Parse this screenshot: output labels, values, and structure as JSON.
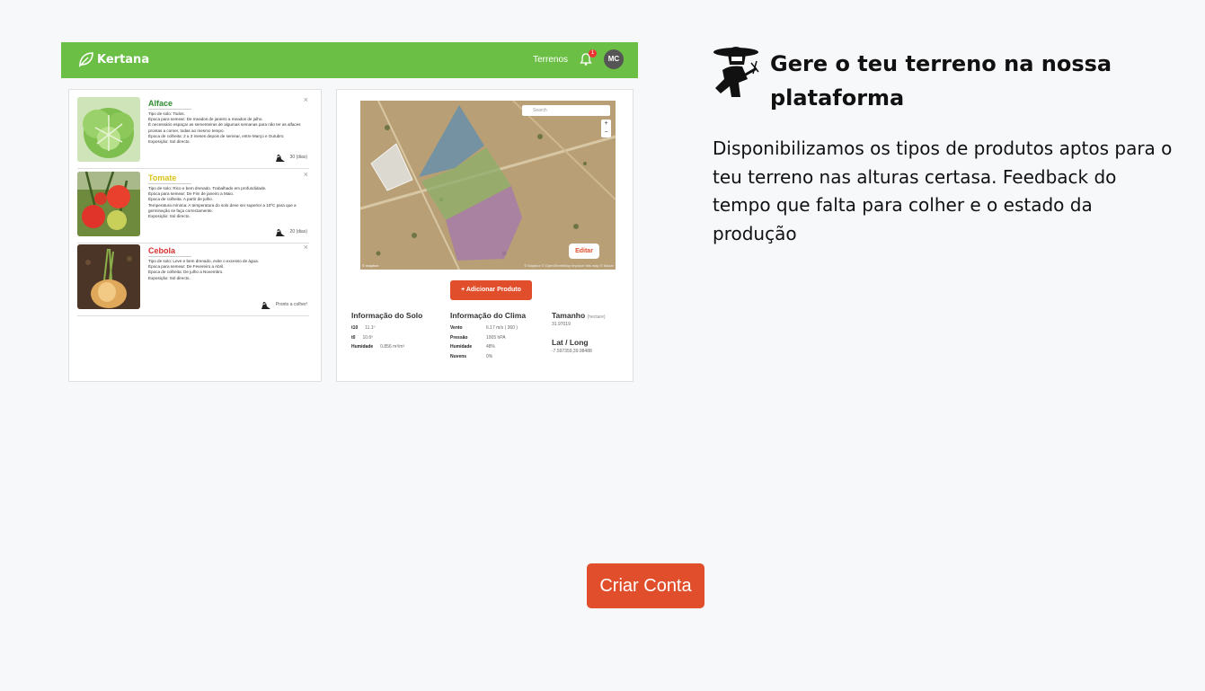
{
  "app": {
    "brand": "Kertana",
    "nav": {
      "terrenos": "Terrenos",
      "notifications": "1",
      "avatar_initials": "MC"
    }
  },
  "crops": [
    {
      "name": "Alface",
      "name_color": "#2e8b2e",
      "description": "Tipo de solo: Todos.\nÉpoca para semear: De meados de janeiro a meados de julho.\nÉ necessário espaçar as sementeiras de algumas semanas para não ter as alfaces prontas a comer, todas ao mesmo tempo.\nÉpoca de colheita: 2 a 3 meses depois de semear, entre Março e Outubro.\nExposição: Sol directo.",
      "meta": "30 (dias)",
      "close": "×"
    },
    {
      "name": "Tomate",
      "name_color": "#d8c31a",
      "description": "Tipo de solo: Rico e bem drenado. Trabalhado em profundidade.\nÉpoca para semear: De Fim de janeiro a Maio.\nÉpoca de colheita: A partir de julho.\nTemperatura mínima: A temperatura do solo deve ser superior a 10ºC para que a germinação se faça correctamente.\nExposição: Sol directo.",
      "meta": "20 (dias)",
      "close": "×"
    },
    {
      "name": "Cebola",
      "name_color": "#d83030",
      "description": "Tipo de solo: Leve e bem drenado, evite o excesso de água.\nÉpoca para semear: De Fevereiro a Abril.\nÉpoca de colheita: De julho a Novembro.\nExposição: Sol directo.",
      "meta": "Pronto a colher!",
      "close": "×"
    }
  ],
  "map": {
    "search_placeholder": "Search",
    "zoom_in": "+",
    "zoom_out": "−",
    "edit_label": "Editar",
    "attribution_left": "© mapbox",
    "attribution_right": "© Mapbox © OpenStreetMap  Improve this map  © Maxar"
  },
  "add_product_label": "+ Adicionar Produto",
  "soil": {
    "title": "Informação do Solo",
    "rows": [
      {
        "label": "t10",
        "value": "11.1º"
      },
      {
        "label": "t0",
        "value": "10.6º"
      },
      {
        "label": "Humidade",
        "value": "0.856 m³/m³"
      }
    ]
  },
  "climate": {
    "title": "Informação do Clima",
    "rows": [
      {
        "label": "Vento",
        "value": "6.17 m/s ( 360 )"
      },
      {
        "label": "Pressão",
        "value": "1005 hPA"
      },
      {
        "label": "Humidade",
        "value": "48%"
      },
      {
        "label": "Nuvens",
        "value": "0%"
      }
    ]
  },
  "size": {
    "title": "Tamanho",
    "unit": "(hectare)",
    "value": "31.97019",
    "latlong_title": "Lat / Long",
    "latlong_value": "-7.597359,39.98488"
  },
  "hero": {
    "title": "Gere o teu terreno na nossa plataforma",
    "description": "Disponibilizamos os tipos de produtos aptos para o teu terreno nas alturas certasa. Feedback do tempo que falta para colher e o estado da produção"
  },
  "cta": {
    "label": "Criar Conta"
  },
  "colors": {
    "brand_green": "#6cbf45",
    "accent_orange": "#e04e2b"
  }
}
